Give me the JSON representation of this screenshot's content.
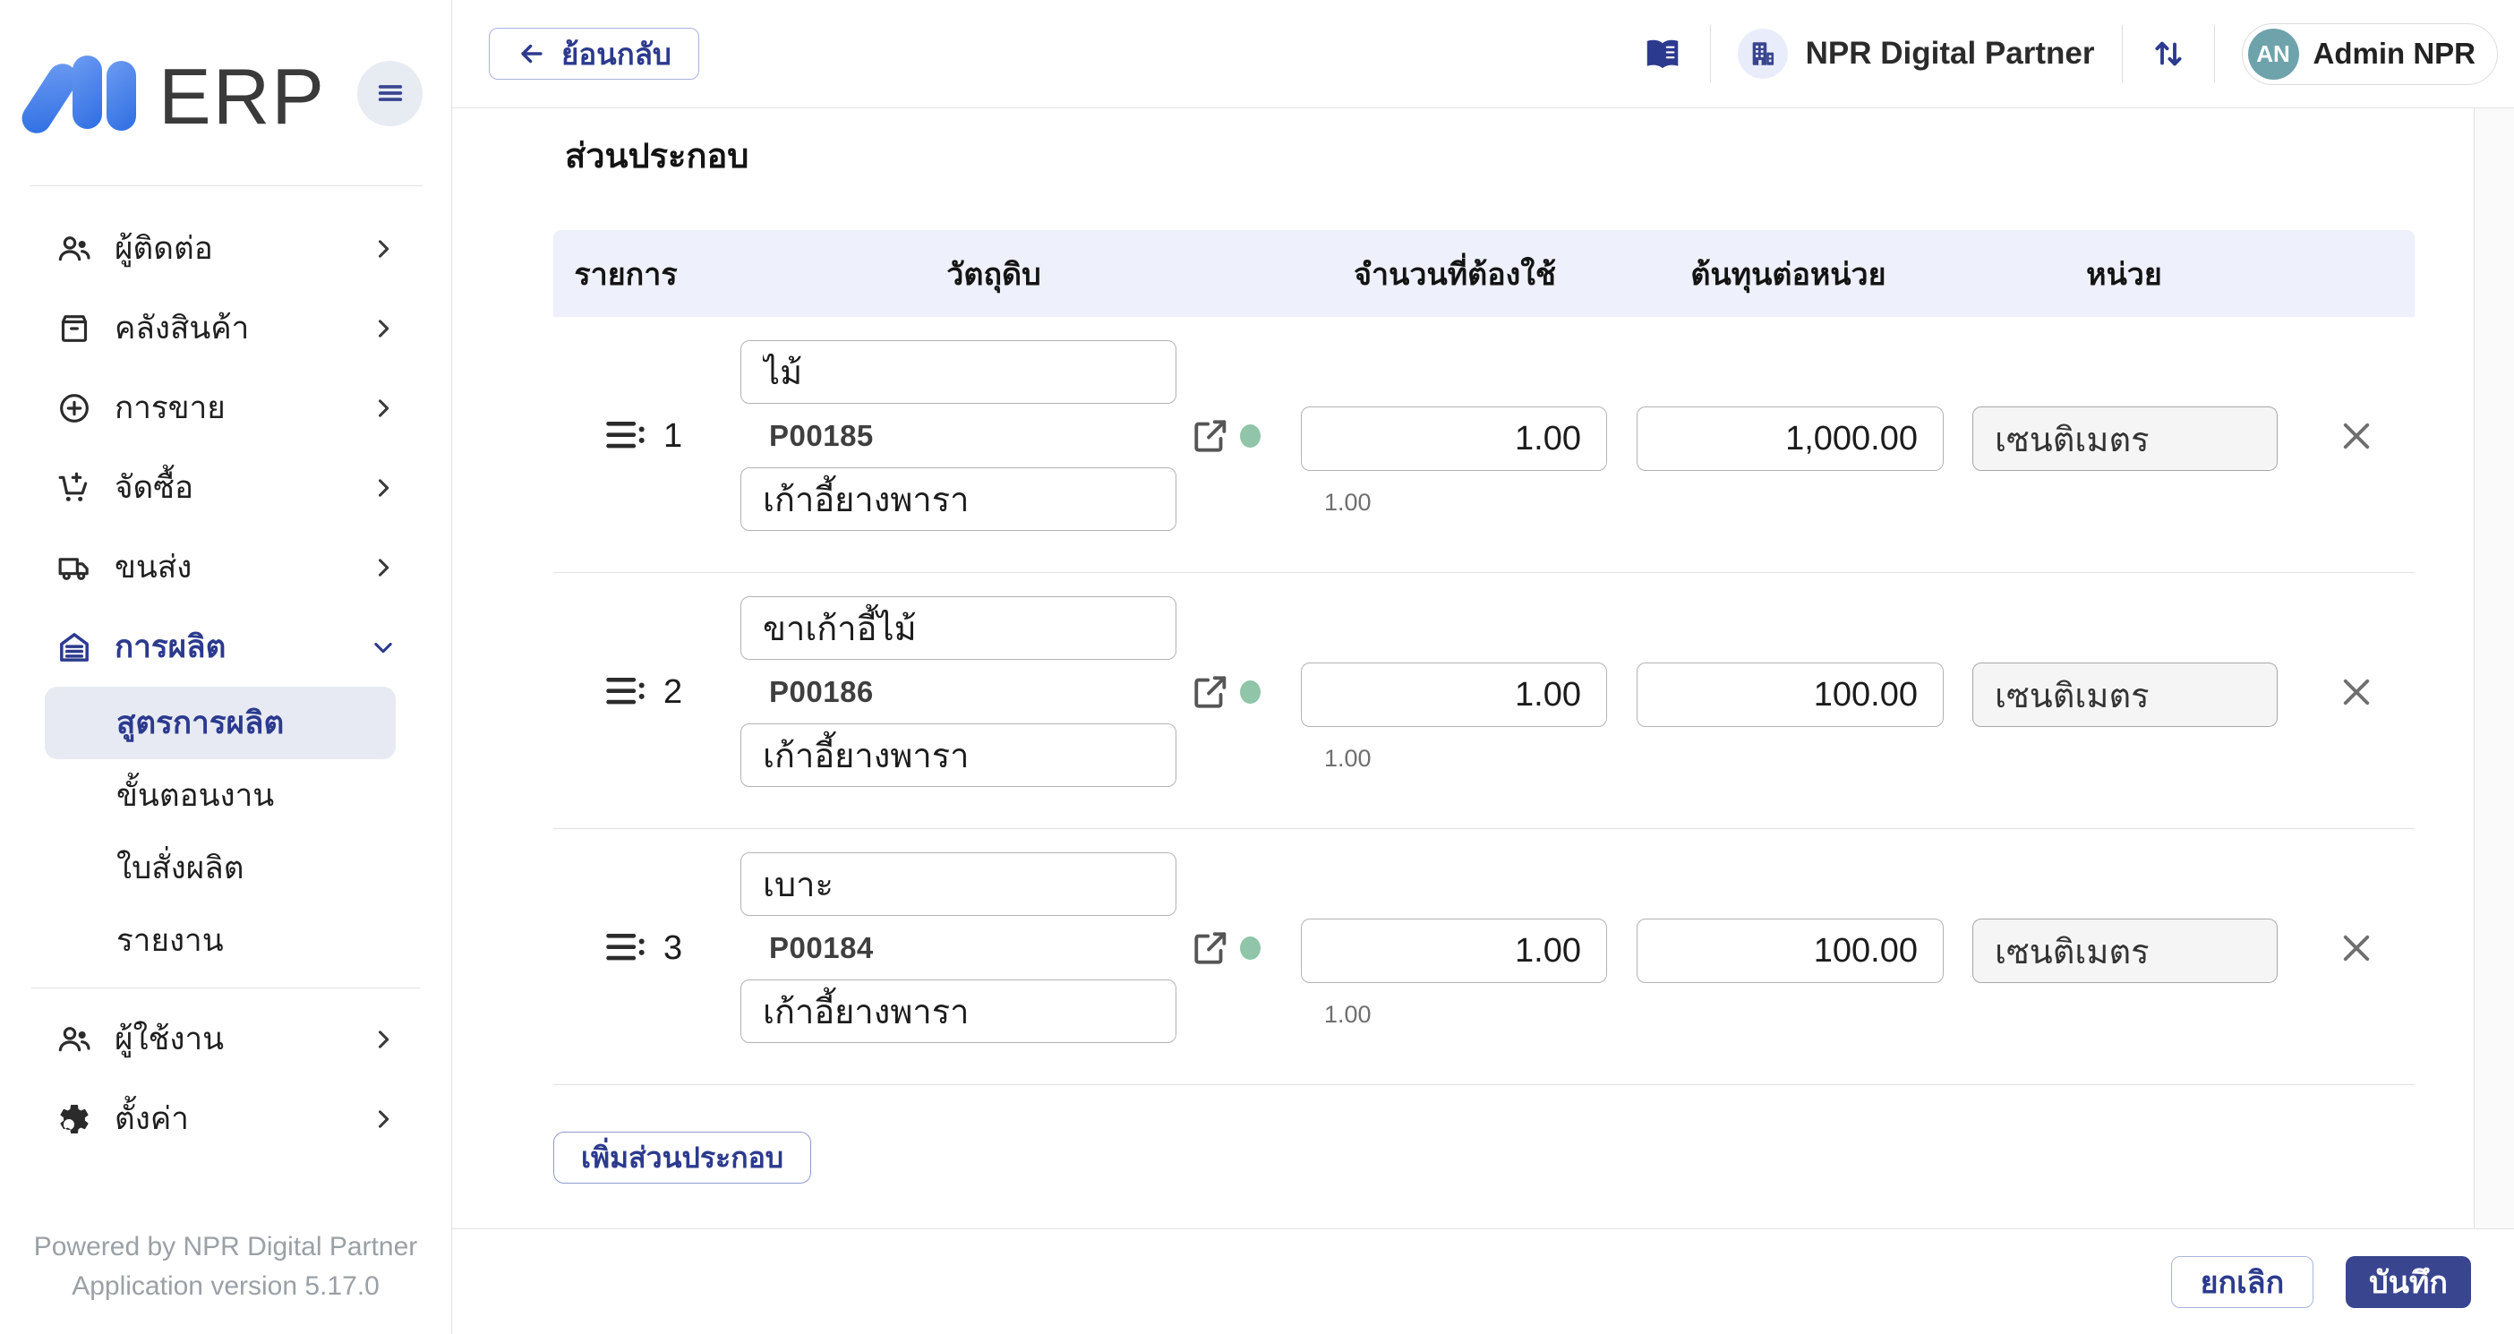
{
  "app": {
    "logo_text": "ERP"
  },
  "colors": {
    "primary": "#39458f",
    "primary_text": "#2c3a8e",
    "table_header_band": "#eef0fb",
    "active_item_bg": "#e7eaf3",
    "status_green": "#90c5a9",
    "avatar_teal": "#6fa3ab",
    "logo_blue_start": "#6c9bf2",
    "logo_blue_end": "#2e6ee2"
  },
  "sidebar": {
    "items": [
      {
        "label": "ผู้ติดต่อ",
        "icon": "contacts-people-icon"
      },
      {
        "label": "คลังสินค้า",
        "icon": "inventory-box-icon"
      },
      {
        "label": "การขาย",
        "icon": "sales-plus-circle-icon"
      },
      {
        "label": "จัดซื้อ",
        "icon": "purchase-cart-icon"
      },
      {
        "label": "ขนส่ง",
        "icon": "shipping-truck-icon"
      },
      {
        "label": "การผลิต",
        "icon": "factory-icon",
        "expanded": true
      },
      {
        "label": "ผู้ใช้งาน",
        "icon": "users-icon"
      },
      {
        "label": "ตั้งค่า",
        "icon": "settings-gear-icon"
      }
    ],
    "production_children": [
      {
        "label": "สูตรการผลิต",
        "active": true
      },
      {
        "label": "ขั้นตอนงาน",
        "active": false
      },
      {
        "label": "ใบสั่งผลิต",
        "active": false
      },
      {
        "label": "รายงาน",
        "active": false
      }
    ],
    "footer_line1": "Powered by NPR Digital Partner",
    "footer_line2": "Application version 5.17.0"
  },
  "topbar": {
    "back_label": "ย้อนกลับ",
    "company_name": "NPR Digital Partner",
    "user_initials": "AN",
    "user_name": "Admin NPR"
  },
  "main": {
    "section_title": "ส่วนประกอบ",
    "table": {
      "headers": [
        "รายการ",
        "วัตถุดิบ",
        "จำนวนที่ต้องใช้",
        "ต้นทุนต่อหน่วย",
        "หน่วย"
      ],
      "rows": [
        {
          "index": "1",
          "material_name": "ไม้",
          "product_code": "P00185",
          "product_name": "เก้าอี้ยางพารา",
          "quantity": "1.00",
          "quantity_helper": "1.00",
          "unit_cost": "1,000.00",
          "unit": "เซนติเมตร",
          "status": "active"
        },
        {
          "index": "2",
          "material_name": "ขาเก้าอี้ไม้",
          "product_code": "P00186",
          "product_name": "เก้าอี้ยางพารา",
          "quantity": "1.00",
          "quantity_helper": "1.00",
          "unit_cost": "100.00",
          "unit": "เซนติเมตร",
          "status": "active"
        },
        {
          "index": "3",
          "material_name": "เบาะ",
          "product_code": "P00184",
          "product_name": "เก้าอี้ยางพารา",
          "quantity": "1.00",
          "quantity_helper": "1.00",
          "unit_cost": "100.00",
          "unit": "เซนติเมตร",
          "status": "active"
        }
      ]
    },
    "add_button_label": "เพิ่มส่วนประกอบ"
  },
  "footer": {
    "cancel_label": "ยกเลิก",
    "save_label": "บันทึก"
  }
}
